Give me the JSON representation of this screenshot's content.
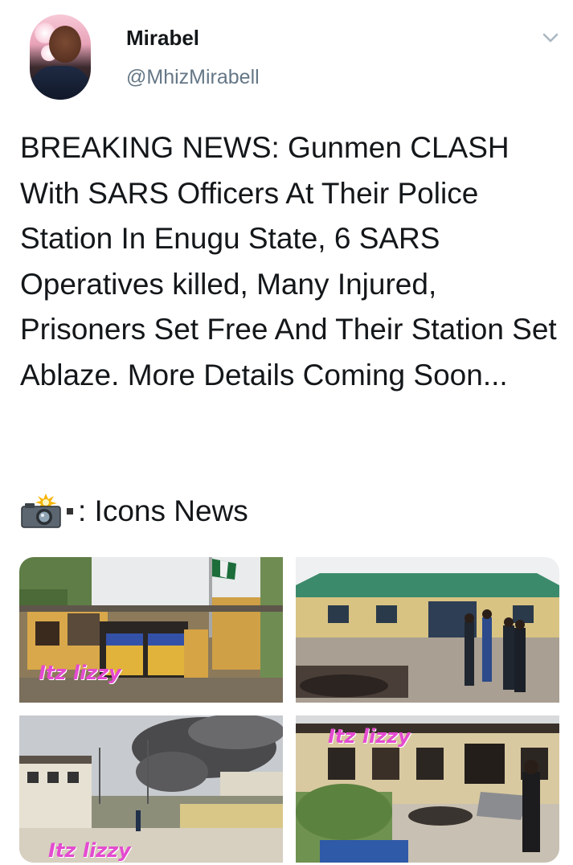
{
  "tweet": {
    "author_name": "Mirabel",
    "author_handle": "@MhizMirabell",
    "text": "BREAKING NEWS: Gunmen CLASH With SARS Officers At Their Police Station In Enugu State, 6 SARS Operatives killed, Many Injured, Prisoners Set Free And Their Station Set Ablaze. More Details Coming Soon...",
    "caption_text": ": Icons News",
    "icons": {
      "menu": "chevron-down-icon",
      "caption_camera": "camera-with-flash-icon",
      "caption_square": "black-small-square-icon"
    }
  },
  "media": {
    "photos": [
      {
        "name": "burned-police-station-gate",
        "watermark": "Itz lizzy"
      },
      {
        "name": "police-station-officers-wreckage",
        "watermark": ""
      },
      {
        "name": "compound-smoke-rising",
        "watermark": "Itz lizzy"
      },
      {
        "name": "burned-building-damaged-vehicles",
        "watermark": "Itz lizzy"
      }
    ]
  },
  "colors": {
    "text_primary": "#14171a",
    "text_secondary": "#657786",
    "watermark": "#e44bd0"
  }
}
